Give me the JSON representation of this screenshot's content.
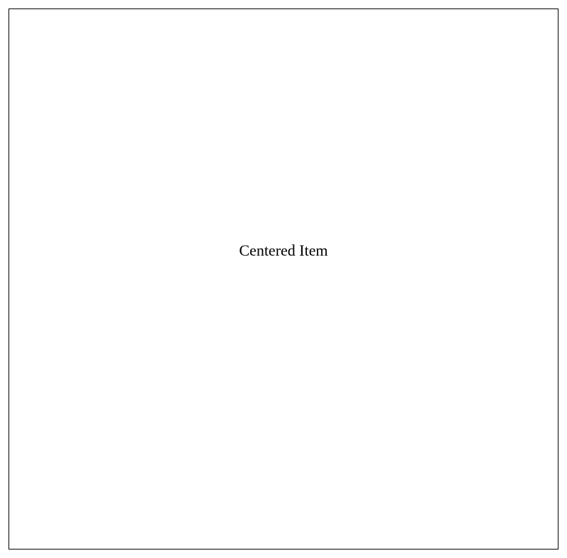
{
  "content": {
    "label": "Centered Item"
  }
}
